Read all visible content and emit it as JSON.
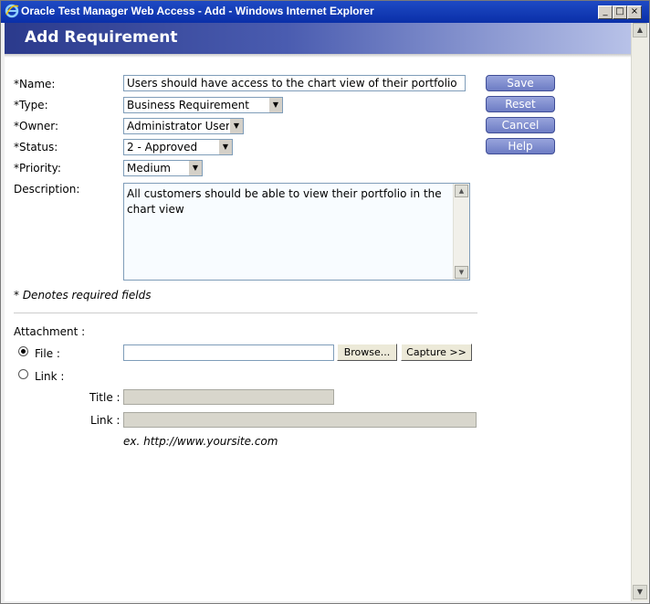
{
  "window": {
    "title": "Oracle Test Manager Web Access - Add - Windows Internet Explorer",
    "min_label": "_",
    "max_label": "□",
    "close_label": "×"
  },
  "page": {
    "title": "Add Requirement"
  },
  "form": {
    "name": {
      "label": "*Name:",
      "value": "Users should have access to the chart view of their portfolio"
    },
    "type": {
      "label": "*Type:",
      "value": "Business Requirement"
    },
    "owner": {
      "label": "*Owner:",
      "value": "Administrator User"
    },
    "status": {
      "label": "*Status:",
      "value": "2 - Approved"
    },
    "priority": {
      "label": "*Priority:",
      "value": "Medium"
    },
    "description": {
      "label": "Description:",
      "value": "All customers should be able to view their portfolio in the\nchart view"
    },
    "required_note": "* Denotes required fields"
  },
  "actions": {
    "save": "Save",
    "reset": "Reset",
    "cancel": "Cancel",
    "help": "Help"
  },
  "attachment": {
    "label": "Attachment :",
    "file_label": "File :",
    "link_label": "Link :",
    "browse": "Browse...",
    "capture": "Capture >>",
    "title_label": "Title :",
    "link_field_label": "Link :",
    "example": "ex. http://www.yoursite.com",
    "selected": "file"
  },
  "colors": {
    "header_dark": "#2b3a8c",
    "button_blue": "#7583c8"
  },
  "icons": {
    "select_arrow": "▼",
    "scroll_up": "▲",
    "scroll_down": "▼"
  }
}
